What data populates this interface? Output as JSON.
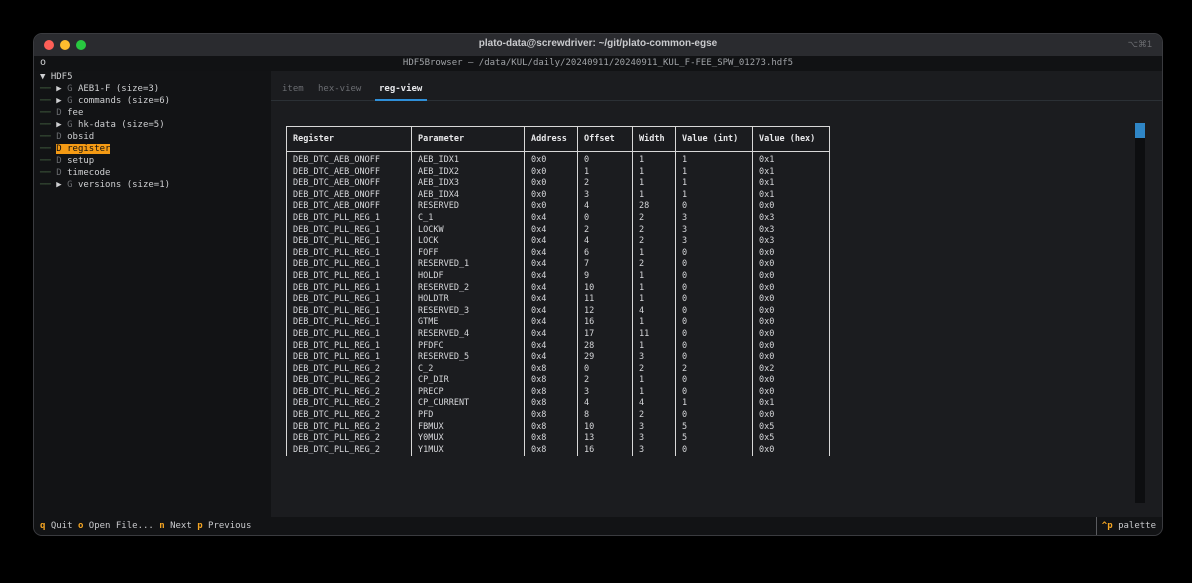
{
  "window": {
    "title": "plato-data@screwdriver: ~/git/plato-common-egse",
    "shortcut": "⌥⌘1"
  },
  "app": {
    "indicator": "o",
    "title": "HDF5Browser — /data/KUL/daily/20240911/20240911_KUL_F-FEE_SPW_01273.hdf5"
  },
  "tree": {
    "root": "▼ HDF5",
    "items": [
      {
        "prefix": "──",
        "arrow": "▶",
        "kind": "G",
        "label": "AEB1-F (size=3)"
      },
      {
        "prefix": "──",
        "arrow": "▶",
        "kind": "G",
        "label": "commands (size=6)"
      },
      {
        "prefix": "──",
        "arrow": "",
        "kind": "D",
        "label": "fee"
      },
      {
        "prefix": "──",
        "arrow": "▶",
        "kind": "G",
        "label": "hk-data (size=5)"
      },
      {
        "prefix": "──",
        "arrow": "",
        "kind": "D",
        "label": "obsid"
      },
      {
        "prefix": "──",
        "arrow": "",
        "kind": "D",
        "label": "register",
        "selected": true
      },
      {
        "prefix": "──",
        "arrow": "",
        "kind": "D",
        "label": "setup"
      },
      {
        "prefix": "──",
        "arrow": "",
        "kind": "D",
        "label": "timecode"
      },
      {
        "prefix": "──",
        "arrow": "▶",
        "kind": "G",
        "label": "versions (size=1)"
      }
    ]
  },
  "tabs": [
    {
      "label": "item",
      "active": false
    },
    {
      "label": "hex-view",
      "active": false
    },
    {
      "label": "reg-view",
      "active": true
    }
  ],
  "table": {
    "headers": [
      "Register",
      "Parameter",
      "Address",
      "Offset",
      "Width",
      "Value (int)",
      "Value (hex)"
    ],
    "rows": [
      [
        "DEB_DTC_AEB_ONOFF",
        "AEB_IDX1",
        "0x0",
        "0",
        "1",
        "1",
        "0x1"
      ],
      [
        "DEB_DTC_AEB_ONOFF",
        "AEB_IDX2",
        "0x0",
        "1",
        "1",
        "1",
        "0x1"
      ],
      [
        "DEB_DTC_AEB_ONOFF",
        "AEB_IDX3",
        "0x0",
        "2",
        "1",
        "1",
        "0x1"
      ],
      [
        "DEB_DTC_AEB_ONOFF",
        "AEB_IDX4",
        "0x0",
        "3",
        "1",
        "1",
        "0x1"
      ],
      [
        "DEB_DTC_AEB_ONOFF",
        "RESERVED",
        "0x0",
        "4",
        "28",
        "0",
        "0x0"
      ],
      [
        "DEB_DTC_PLL_REG_1",
        "C_1",
        "0x4",
        "0",
        "2",
        "3",
        "0x3"
      ],
      [
        "DEB_DTC_PLL_REG_1",
        "LOCKW",
        "0x4",
        "2",
        "2",
        "3",
        "0x3"
      ],
      [
        "DEB_DTC_PLL_REG_1",
        "LOCK",
        "0x4",
        "4",
        "2",
        "3",
        "0x3"
      ],
      [
        "DEB_DTC_PLL_REG_1",
        "FOFF",
        "0x4",
        "6",
        "1",
        "0",
        "0x0"
      ],
      [
        "DEB_DTC_PLL_REG_1",
        "RESERVED_1",
        "0x4",
        "7",
        "2",
        "0",
        "0x0"
      ],
      [
        "DEB_DTC_PLL_REG_1",
        "HOLDF",
        "0x4",
        "9",
        "1",
        "0",
        "0x0"
      ],
      [
        "DEB_DTC_PLL_REG_1",
        "RESERVED_2",
        "0x4",
        "10",
        "1",
        "0",
        "0x0"
      ],
      [
        "DEB_DTC_PLL_REG_1",
        "HOLDTR",
        "0x4",
        "11",
        "1",
        "0",
        "0x0"
      ],
      [
        "DEB_DTC_PLL_REG_1",
        "RESERVED_3",
        "0x4",
        "12",
        "4",
        "0",
        "0x0"
      ],
      [
        "DEB_DTC_PLL_REG_1",
        "GTME",
        "0x4",
        "16",
        "1",
        "0",
        "0x0"
      ],
      [
        "DEB_DTC_PLL_REG_1",
        "RESERVED_4",
        "0x4",
        "17",
        "11",
        "0",
        "0x0"
      ],
      [
        "DEB_DTC_PLL_REG_1",
        "PFDFC",
        "0x4",
        "28",
        "1",
        "0",
        "0x0"
      ],
      [
        "DEB_DTC_PLL_REG_1",
        "RESERVED_5",
        "0x4",
        "29",
        "3",
        "0",
        "0x0"
      ],
      [
        "DEB_DTC_PLL_REG_2",
        "C_2",
        "0x8",
        "0",
        "2",
        "2",
        "0x2"
      ],
      [
        "DEB_DTC_PLL_REG_2",
        "CP_DIR",
        "0x8",
        "2",
        "1",
        "0",
        "0x0"
      ],
      [
        "DEB_DTC_PLL_REG_2",
        "PRECP",
        "0x8",
        "3",
        "1",
        "0",
        "0x0"
      ],
      [
        "DEB_DTC_PLL_REG_2",
        "CP_CURRENT",
        "0x8",
        "4",
        "4",
        "1",
        "0x1"
      ],
      [
        "DEB_DTC_PLL_REG_2",
        "PFD",
        "0x8",
        "8",
        "2",
        "0",
        "0x0"
      ],
      [
        "DEB_DTC_PLL_REG_2",
        "FBMUX",
        "0x8",
        "10",
        "3",
        "5",
        "0x5"
      ],
      [
        "DEB_DTC_PLL_REG_2",
        "Y0MUX",
        "0x8",
        "13",
        "3",
        "5",
        "0x5"
      ],
      [
        "DEB_DTC_PLL_REG_2",
        "Y1MUX",
        "0x8",
        "16",
        "3",
        "0",
        "0x0"
      ]
    ]
  },
  "footer": {
    "bindings": [
      {
        "key": "q",
        "label": "Quit"
      },
      {
        "key": "o",
        "label": "Open File..."
      },
      {
        "key": "n",
        "label": "Next"
      },
      {
        "key": "p",
        "label": "Previous"
      }
    ],
    "palette_key": "^p",
    "palette_label": "palette"
  },
  "colors": {
    "accent": "#f49a14",
    "tab_underline": "#2f8fd8"
  }
}
